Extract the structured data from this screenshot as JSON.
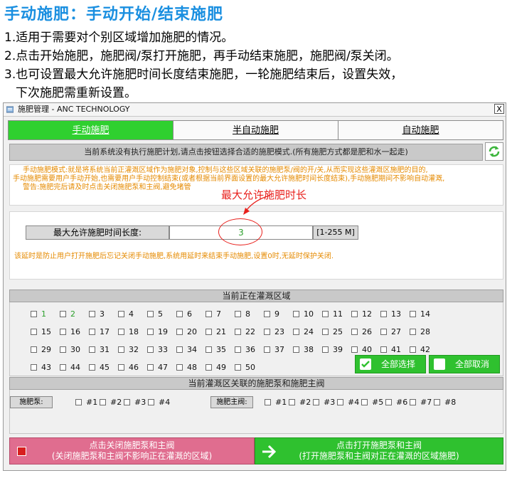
{
  "slide": {
    "title": "手动施肥：手动开始/结束施肥",
    "notes": [
      "1.适用于需要对个别区域增加施肥的情况。",
      "2.点击开始施肥，施肥阀/泵打开施肥，再手动结束施肥，施肥阀/泵关闭。",
      "3.也可设置最大允许施肥时间长度结束施肥，一轮施肥结束后，设置失效，",
      "下次施肥需重新设置。"
    ]
  },
  "window": {
    "title": "施肥管理 - ANC TECHNOLOGY",
    "close_label": "X",
    "tabs": [
      "手动施肥",
      "半自动施肥",
      "自动施肥"
    ],
    "status_text": "当前系统没有执行施肥计划,请点击按钮选择合适的施肥模式.(所有施肥方式都是肥和水一起走)",
    "description": {
      "line1": "手动施肥模式:就是将系统当前正灌溉区域作为施肥对象,控制与这些区域关联的施肥泵/阀的开/关,从而实现这些灌溉区施肥的目的,",
      "line2": "手动施肥需要用户手动开始,也需要用户手动控制结束(或者根据当前界面设置的最大允许施肥时间长度结束),手动施肥期间不影响自动灌溉,",
      "line3": "警告:施肥完后请及时点击关闭施肥泵和主阀,避免堵管"
    },
    "annotation": "最大允许施肥时长",
    "duration": {
      "label": "最大允许施肥时间长度:",
      "value": "3",
      "range": "[1-255 M]"
    },
    "delay_note": "该延时是防止用户打开施肥后忘记关闭手动施肥,系统用延时来结束手动施肥,设置0时,无延时保护关闭.",
    "zone_section": {
      "header": "当前正在灌溉区域",
      "zones": [
        "1",
        "2",
        "3",
        "4",
        "5",
        "6",
        "7",
        "8",
        "9",
        "10",
        "11",
        "12",
        "13",
        "14",
        "15",
        "16",
        "17",
        "18",
        "19",
        "20",
        "21",
        "22",
        "23",
        "24",
        "25",
        "26",
        "27",
        "28",
        "29",
        "30",
        "31",
        "32",
        "33",
        "34",
        "35",
        "36",
        "37",
        "38",
        "39",
        "40",
        "41",
        "42",
        "43",
        "44",
        "45",
        "46",
        "47",
        "48",
        "49",
        "50"
      ],
      "active_zones": [
        "1",
        "2"
      ],
      "select_all": "全部选择",
      "cancel_all": "全部取消"
    },
    "pump_section": {
      "header": "当前灌溉区关联的施肥泵和施肥主阀",
      "pump_label": "施肥泵:",
      "pumps": [
        "#1",
        "#2",
        "#3",
        "#4"
      ],
      "valve_label": "施肥主阀:",
      "valves": [
        "#1",
        "#2",
        "#3",
        "#4",
        "#5",
        "#6",
        "#7",
        "#8"
      ]
    },
    "actions": {
      "close_title": "点击关闭施肥泵和主阀",
      "close_sub": "(关闭施肥泵和主阀不影响正在灌溉的区域)",
      "open_title": "点击打开施肥泵和主阀",
      "open_sub": "(打开施肥泵和主阀对正在灌溉的区域施肥)"
    },
    "colors": {
      "accent_green": "#2fc12f",
      "danger_pink": "#e06d8f",
      "warning_orange": "#e58a00",
      "annotation_red": "#e8201c",
      "title_blue": "#1a8fe0"
    }
  }
}
